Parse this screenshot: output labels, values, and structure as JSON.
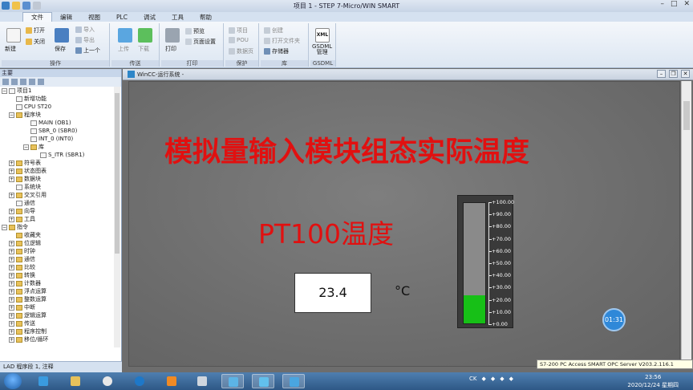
{
  "window": {
    "title": "项目 1 - STEP 7-Micro/WIN SMART"
  },
  "menu": [
    "文件",
    "编辑",
    "视图",
    "PLC",
    "调试",
    "工具",
    "帮助"
  ],
  "ribbon": {
    "groups": {
      "operation": "操作",
      "transfer": "传送",
      "print": "打印",
      "protect": "保护",
      "library": "库",
      "gsdml": "GSDML"
    },
    "buttons": {
      "new": "新建",
      "open": "打开",
      "close": "关闭",
      "save": "保存",
      "import": "导入",
      "export": "导出",
      "previous": "上一个",
      "upload": "上传",
      "download": "下载",
      "print": "打印",
      "preview": "预览",
      "page_setup": "页面设置",
      "project": "项目",
      "pou": "POU",
      "data_page": "数据页",
      "create": "创建",
      "open_folder": "打开文件夹",
      "memory": "存储器",
      "xml": "XML",
      "gsdml_manage": "GSDML\n管理"
    }
  },
  "left_panel": {
    "header": "主要",
    "tree": [
      "项目1",
      "新增功能",
      "CPU ST20",
      "程序块",
      "MAIN (OB1)",
      "SBR_0 (SBR0)",
      "INT_0 (INT0)",
      "库",
      "S_ITR (SBR1)",
      "符号表",
      "状态图表",
      "数据块",
      "系统块",
      "交叉引用",
      "通信",
      "向导",
      "工具",
      "指令",
      "收藏夹",
      "位逻辑",
      "时钟",
      "通信",
      "比较",
      "转换",
      "计数器",
      "浮点运算",
      "整数运算",
      "中断",
      "逻辑运算",
      "传送",
      "程序控制",
      "移位/循环"
    ],
    "status": "LAD 程序段 1, 注释"
  },
  "wincc": {
    "title": "WinCC-运行系统 -",
    "heading": "模拟量输入模块组态实际温度",
    "subheading": "PT100温度",
    "value": "23.4",
    "unit": "°C",
    "gauge": {
      "labels": [
        "+100.00",
        "+90.00",
        "+80.00",
        "+70.00",
        "+60.00",
        "+50.00",
        "+40.00",
        "+30.00",
        "+20.00",
        "+10.00",
        "+0.00"
      ],
      "min": 0,
      "max": 100,
      "level": 23.4,
      "fill_color": "#17c017"
    },
    "timer": "01:31"
  },
  "taskbar": {
    "opc_tip": "S7-200 PC Access SMART OPC Server V203.2.116.1",
    "lang": "CK",
    "time": "23:56",
    "date": "2020/12/24 星期四"
  }
}
